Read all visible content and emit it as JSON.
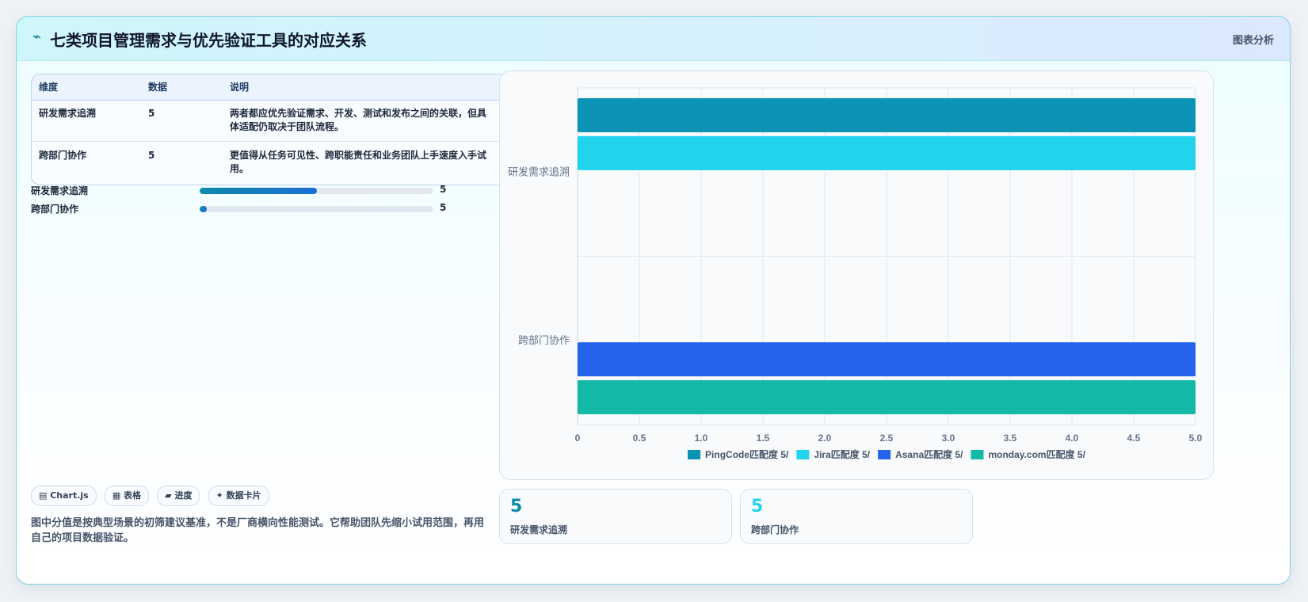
{
  "header": {
    "icon": "pulse-icon",
    "title": "七类项目管理需求与优先验证工具的对应关系",
    "right_label": "图表分析"
  },
  "table": {
    "headers": [
      "维度",
      "数据",
      "说明"
    ],
    "rows": [
      {
        "dim": "研发需求追溯",
        "value": "5",
        "desc": "两者都应优先验证需求、开发、测试和发布之间的关联，但具体适配仍取决于团队流程。"
      },
      {
        "dim": "跨部门协作",
        "value": "5",
        "desc": "更值得从任务可见性、跨职能责任和业务团队上手速度入手试用。"
      }
    ]
  },
  "progress": [
    {
      "label": "研发需求追溯",
      "value": "5",
      "fill": 0.5
    },
    {
      "label": "跨部门协作",
      "value": "5",
      "fill": 0.03
    }
  ],
  "tags": [
    "▤ Chart.js",
    "▦ 表格",
    "▰ 进度",
    "✦ 数据卡片"
  ],
  "note": "图中分值是按典型场景的初筛建议基准，不是厂商横向性能测试。它帮助团队先缩小试用范围，再用自己的项目数据验证。",
  "stats": [
    {
      "value": "5",
      "label": "研发需求追溯",
      "color": "#0e89a9"
    },
    {
      "value": "5",
      "label": "跨部门协作",
      "color": "#22d3ee"
    }
  ],
  "chart_data": {
    "type": "bar",
    "orientation": "horizontal",
    "categories": [
      "研发需求追溯",
      "跨部门协作"
    ],
    "series": [
      {
        "name": "PingCode匹配度 5/",
        "color": "#0b93b5",
        "values": [
          5,
          null
        ]
      },
      {
        "name": "Jira匹配度 5/",
        "color": "#22d3ee",
        "values": [
          5,
          null
        ]
      },
      {
        "name": "Asana匹配度 5/",
        "color": "#2563eb",
        "values": [
          null,
          5
        ]
      },
      {
        "name": "monday.com匹配度 5/",
        "color": "#14b8a6",
        "values": [
          null,
          5
        ]
      }
    ],
    "x_ticks": [
      "0",
      "0.5",
      "1.0",
      "1.5",
      "2.0",
      "2.5",
      "3.0",
      "3.5",
      "4.0",
      "4.5",
      "5.0"
    ],
    "xlim": [
      0,
      5
    ],
    "grid": true,
    "legend_position": "bottom"
  }
}
